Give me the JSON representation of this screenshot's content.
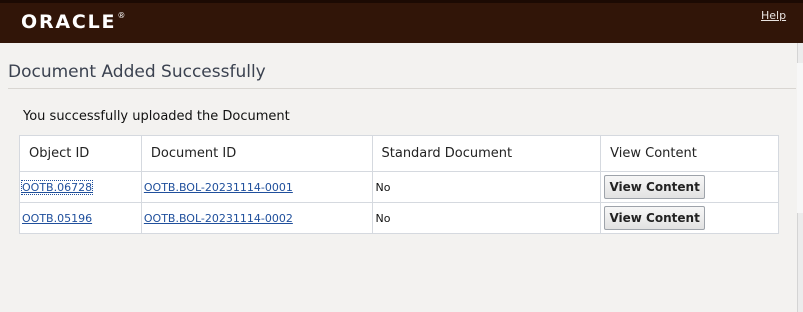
{
  "header": {
    "logo_text": "ORACLE",
    "logo_mark": "®",
    "help_label": "Help",
    "colors": {
      "bar": "#311508",
      "text": "#ffffff"
    }
  },
  "page": {
    "title": "Document Added Successfully",
    "message": "You successfully uploaded the Document"
  },
  "table": {
    "columns": [
      "Object ID",
      "Document ID",
      "Standard Document",
      "View Content"
    ],
    "rows": [
      {
        "object_id": "OOTB.06728",
        "document_id": "OOTB.BOL-20231114-0001",
        "standard_document": "No",
        "button_label": "View Content"
      },
      {
        "object_id": "OOTB.05196",
        "document_id": "OOTB.BOL-20231114-0002",
        "standard_document": "No",
        "button_label": "View Content"
      }
    ]
  },
  "colors": {
    "link": "#1f4f9c",
    "title": "#3b4250",
    "background": "#f3f2f0"
  }
}
